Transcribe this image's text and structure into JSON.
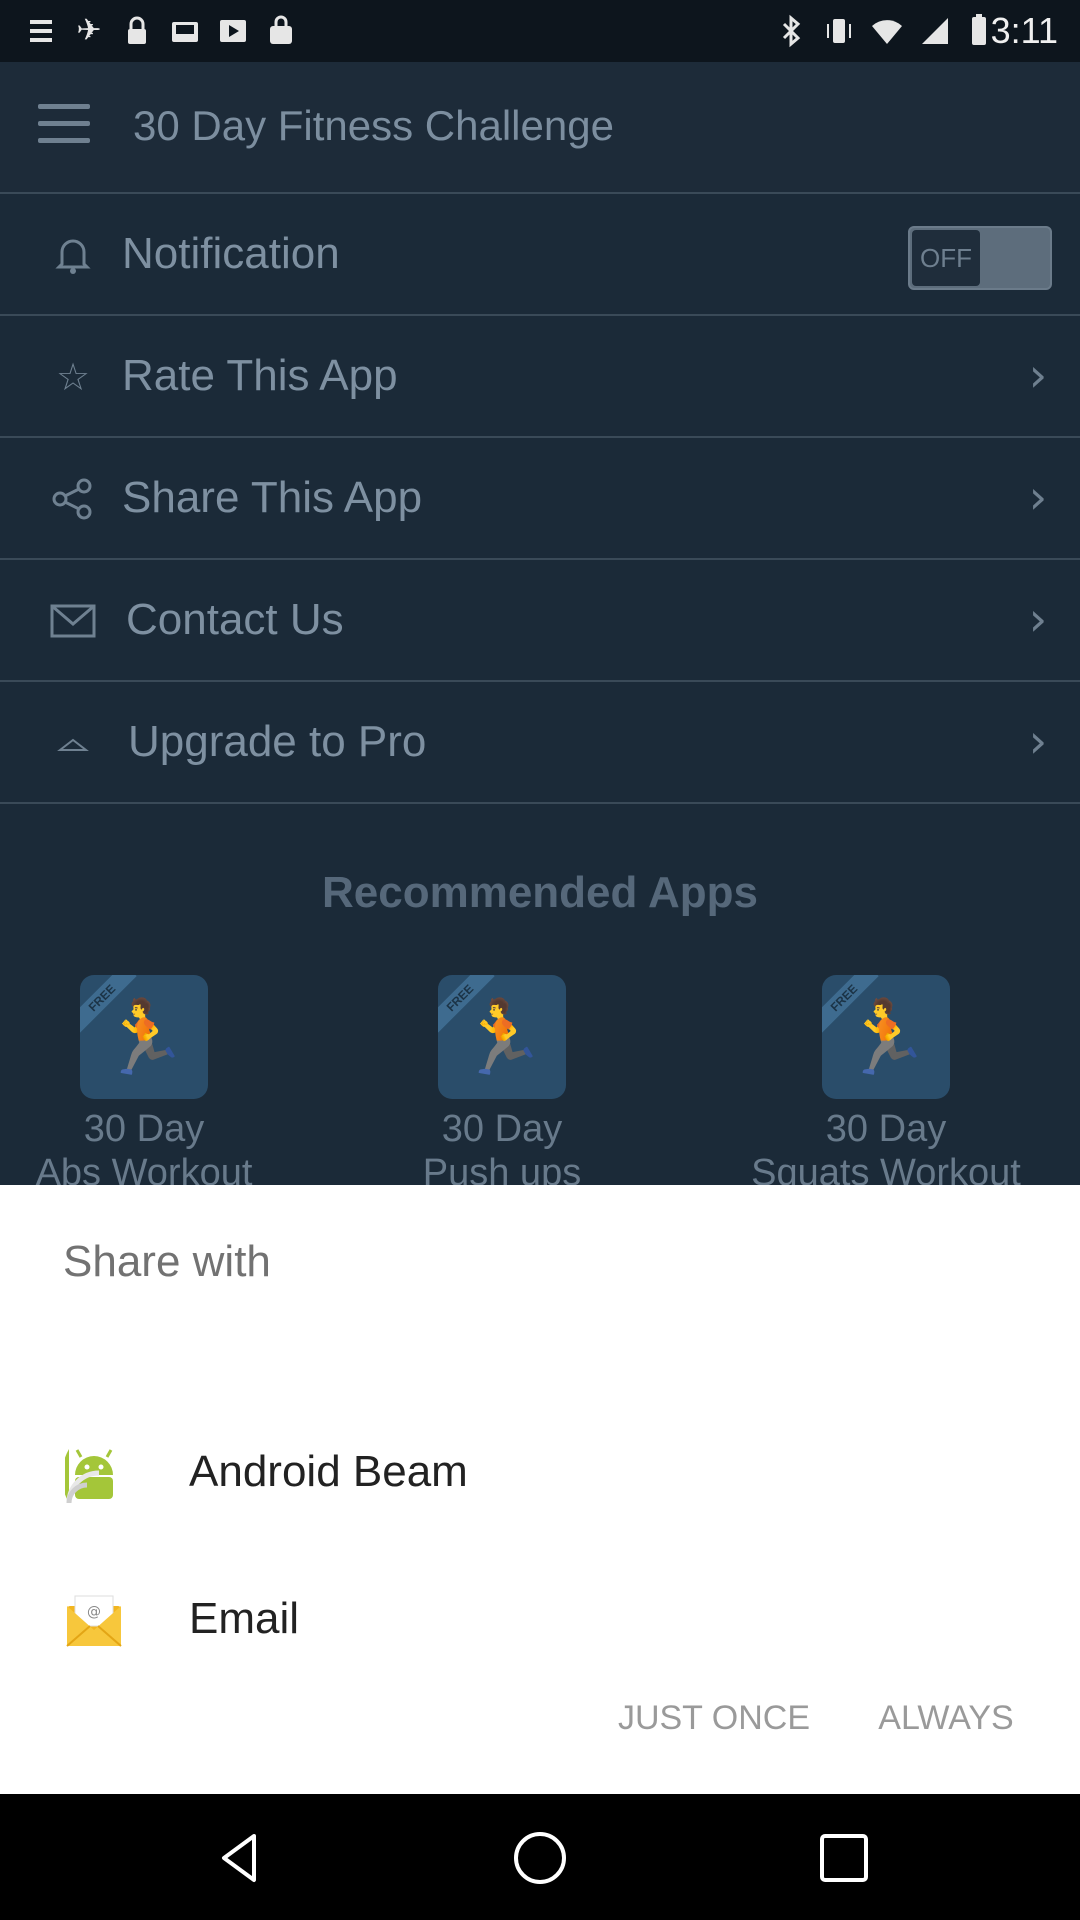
{
  "status_bar": {
    "time": "3:11",
    "left_icons": [
      "menu-icon",
      "fake-gps-icon",
      "lock-icon",
      "inbox-icon",
      "video-icon",
      "bag-icon"
    ],
    "right_icons": [
      "bluetooth-icon",
      "vibrate-icon",
      "wifi-icon",
      "cellular-icon",
      "battery-icon"
    ]
  },
  "app_bar": {
    "title": "30 Day Fitness Challenge"
  },
  "settings": {
    "items": [
      {
        "label": "Notification",
        "icon": "bell-icon",
        "toggle": "OFF"
      },
      {
        "label": "Rate This App",
        "icon": "star-icon"
      },
      {
        "label": "Share This App",
        "icon": "share-icon"
      },
      {
        "label": "Contact Us",
        "icon": "envelope-icon"
      },
      {
        "label": "Upgrade to Pro",
        "icon": "upgrade-icon"
      }
    ]
  },
  "recommended": {
    "title": "Recommended Apps",
    "apps": [
      {
        "line1": "30 Day",
        "line2": "Abs Workout"
      },
      {
        "line1": "30 Day",
        "line2": "Push ups Workout"
      },
      {
        "line1": "30 Day",
        "line2": "Squats Workout"
      }
    ],
    "badge": "FREE"
  },
  "share_sheet": {
    "title": "Share with",
    "options": [
      {
        "label": "Android Beam",
        "icon": "android-beam-icon"
      },
      {
        "label": "Email",
        "icon": "email-icon"
      }
    ],
    "just_once": "JUST ONCE",
    "always": "ALWAYS"
  },
  "nav_bar": {
    "icons": [
      "back-icon",
      "home-icon",
      "recents-icon"
    ]
  },
  "colors": {
    "background_dim": "#1b2a38",
    "sheet_bg": "#ffffff",
    "android_green": "#a4c639"
  }
}
